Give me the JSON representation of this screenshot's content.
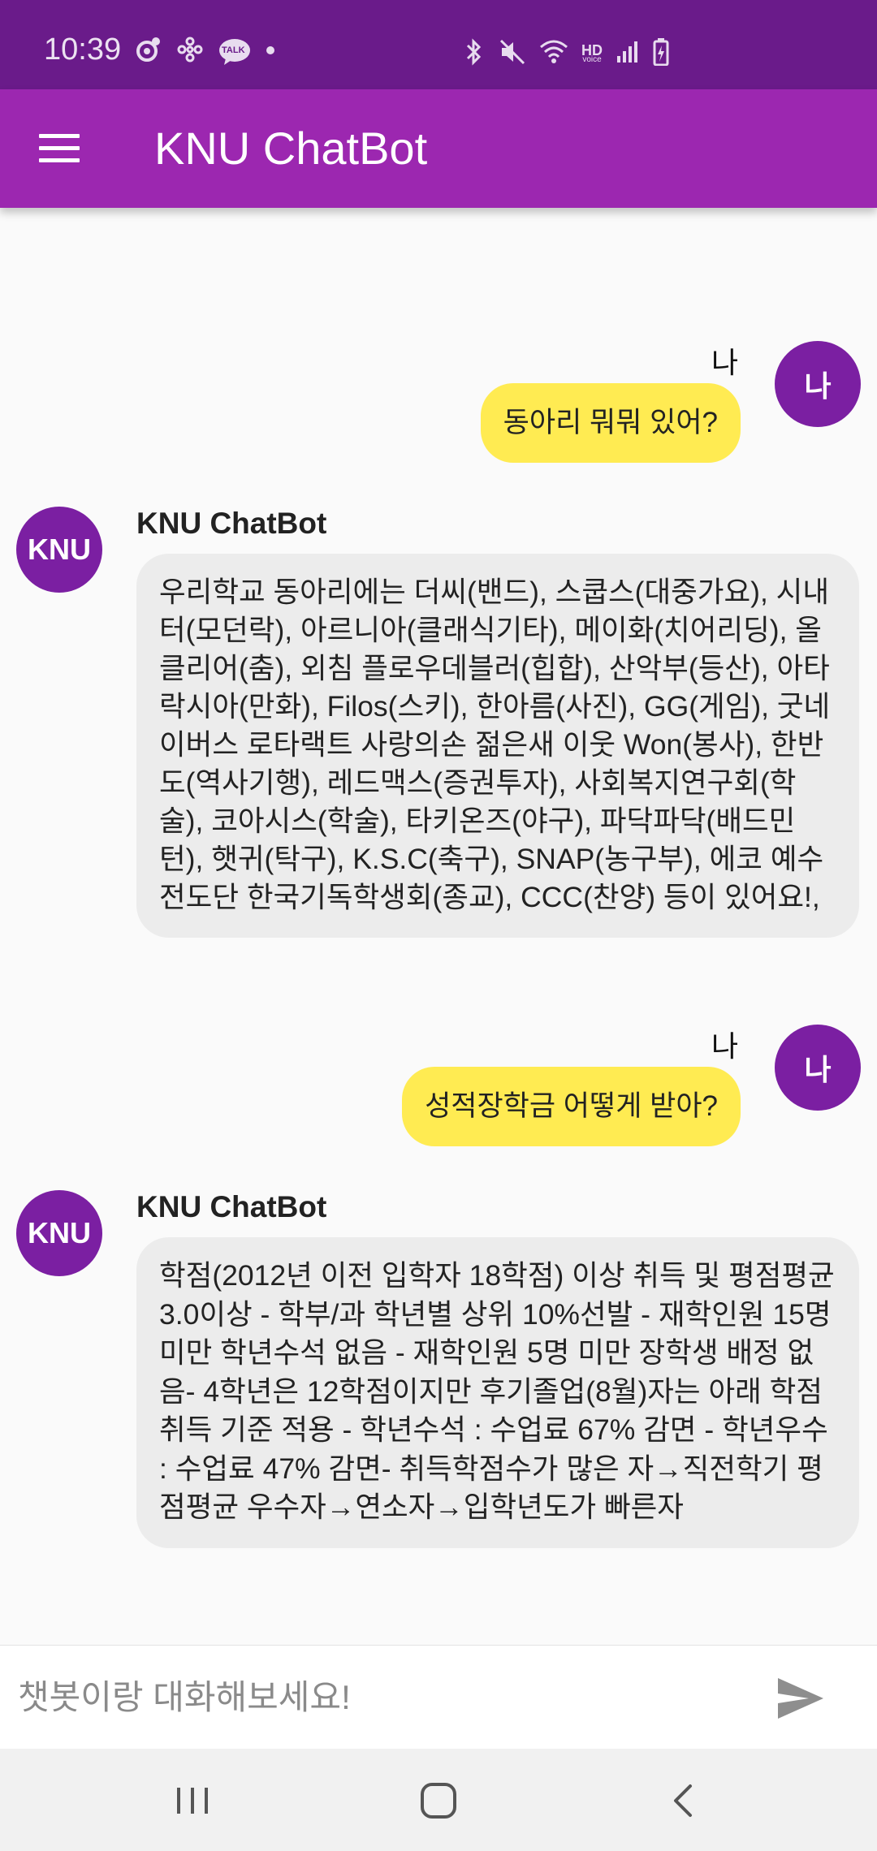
{
  "status_bar": {
    "time": "10:39",
    "left_icons": [
      "notification-icon",
      "pinwheel-icon",
      "talk-icon",
      "dot-icon"
    ],
    "talk_label": "TALK",
    "hd_label": "HD",
    "voice_label": "voice",
    "right_icons": [
      "bluetooth-icon",
      "mute-icon",
      "wifi-icon",
      "hd-voice-icon",
      "signal-icon",
      "battery-icon"
    ]
  },
  "app_bar": {
    "title": "KNU ChatBot",
    "menu_icon": "hamburger-menu-icon"
  },
  "messages": [
    {
      "sender": "me",
      "sender_label": "나",
      "avatar_text": "나",
      "text": "동아리 뭐뭐 있어?"
    },
    {
      "sender": "bot",
      "sender_label": "KNU ChatBot",
      "avatar_text": "KNU",
      "text": "우리학교 동아리에는 더씨(밴드), 스쿱스(대중가요), 시내터(모던락), 아르니아(클래식기타), 메이화(치어리딩), 올클리어(춤), 외침 플로우데블러(힙합), 산악부(등산), 아타락시아(만화), Filos(스키), 한아름(사진), GG(게임), 굿네이버스 로타랙트 사랑의손 젊은새 이웃 Won(봉사), 한반도(역사기행), 레드맥스(증권투자), 사회복지연구회(학술), 코아시스(학술), 타키온즈(야구), 파닥파닥(배드민턴), 햇귀(탁구), K.S.C(축구), SNAP(농구부), 에코 예수전도단 한국기독학생회(종교), CCC(찬양) 등이 있어요!,"
    },
    {
      "sender": "me",
      "sender_label": "나",
      "avatar_text": "나",
      "text": "성적장학금 어떻게 받아?"
    },
    {
      "sender": "bot",
      "sender_label": "KNU ChatBot",
      "avatar_text": "KNU",
      "text": "학점(2012년 이전 입학자 18학점) 이상 취득 및 평점평균 3.0이상 - 학부/과 학년별 상위 10%선발 - 재학인원 15명 미만 학년수석 없음 - 재학인원 5명 미만 장학생 배정 없음- 4학년은 12학점이지만 후기졸업(8월)자는 아래 학점취득 기준 적용 - 학년수석 : 수업료 67% 감면 - 학년우수 : 수업료 47% 감면- 취득학점수가 많은 자→직전학기 평점평균 우수자→연소자→입학년도가 빠른자"
    }
  ],
  "input": {
    "placeholder": "챗봇이랑 대화해보세요!",
    "value": "",
    "send_icon": "send-icon"
  },
  "nav_bar": {
    "buttons": [
      "recent-apps-icon",
      "home-icon",
      "back-icon"
    ]
  },
  "colors": {
    "status_bar": "#6a1b8a",
    "app_bar": "#9c27b0",
    "avatar": "#7b1fa2",
    "user_bubble": "#ffeb52",
    "bot_bubble": "#ececec"
  }
}
